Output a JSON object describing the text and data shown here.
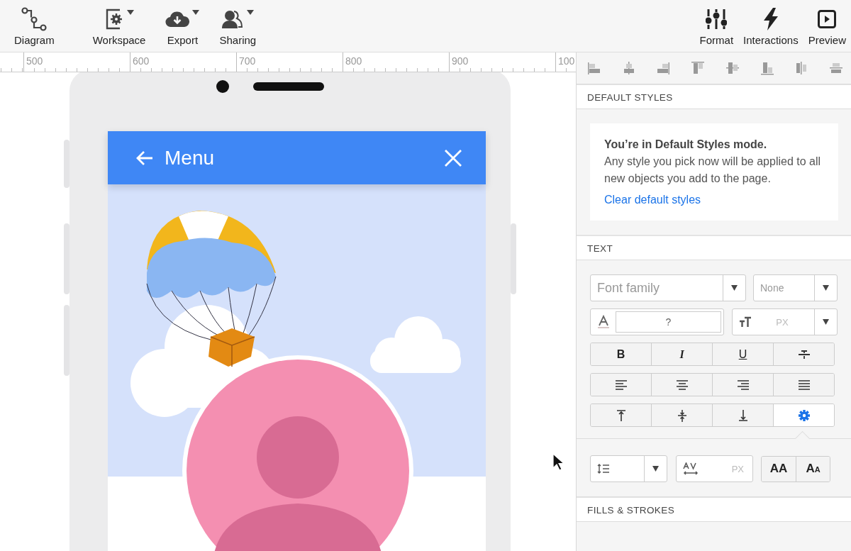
{
  "toolbar": {
    "left": [
      {
        "label": "Diagram",
        "kind": "diagram",
        "dropdown": false
      },
      {
        "label": "Workspace",
        "kind": "workspace",
        "dropdown": true
      },
      {
        "label": "Export",
        "kind": "export",
        "dropdown": true
      },
      {
        "label": "Sharing",
        "kind": "sharing",
        "dropdown": true
      }
    ],
    "right": [
      {
        "label": "Format",
        "kind": "format"
      },
      {
        "label": "Interactions",
        "kind": "interactions"
      },
      {
        "label": "Preview",
        "kind": "preview"
      }
    ]
  },
  "ruler": {
    "marks": [
      "500",
      "600",
      "700",
      "800",
      "900",
      "100"
    ]
  },
  "canvas": {
    "app_header": {
      "title": "Menu"
    }
  },
  "panel": {
    "default_styles": {
      "heading": "DEFAULT STYLES",
      "title": "You’re in Default Styles mode.",
      "body": "Any style you pick now will be applied to all new objects you add to the page.",
      "link": "Clear default styles"
    },
    "text": {
      "heading": "TEXT",
      "font_family": {
        "placeholder": "Font family"
      },
      "font_weight": {
        "value": "None"
      },
      "color_field": {
        "value": "?"
      },
      "size_field": {
        "unit": "PX"
      },
      "style_buttons": [
        {
          "kind": "bold",
          "label": "B"
        },
        {
          "kind": "italic",
          "label": "I"
        },
        {
          "kind": "underline",
          "label": "U"
        },
        {
          "kind": "strike"
        }
      ],
      "align_buttons": [
        {
          "kind": "left"
        },
        {
          "kind": "center"
        },
        {
          "kind": "right"
        },
        {
          "kind": "justify"
        }
      ],
      "valign_buttons": [
        {
          "kind": "top",
          "selected": false
        },
        {
          "kind": "middle",
          "selected": false
        },
        {
          "kind": "bottom",
          "selected": false
        },
        {
          "kind": "settings",
          "selected": true
        }
      ],
      "spacing_field": {
        "unit": "PX"
      },
      "case_buttons": [
        {
          "kind": "upper",
          "label": "AA"
        },
        {
          "kind": "smallcaps",
          "label": "AA"
        }
      ]
    },
    "fills_heading": "FILLS & STROKES"
  }
}
